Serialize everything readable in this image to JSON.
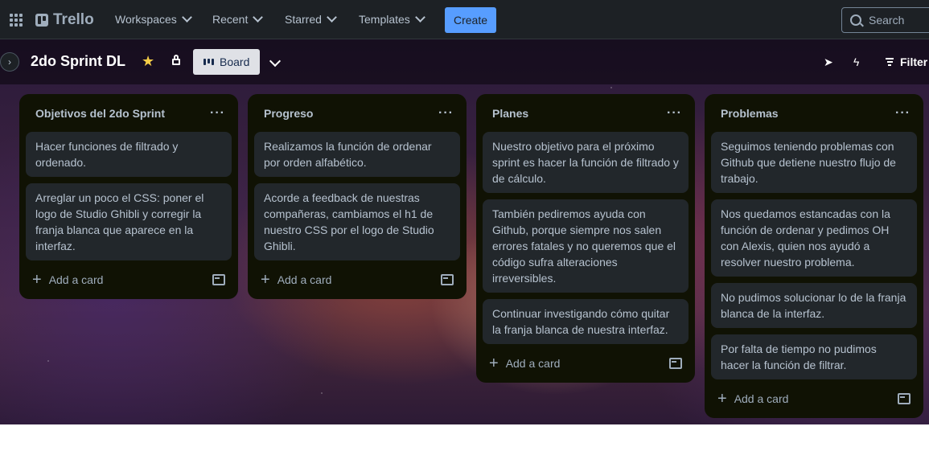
{
  "nav": {
    "logo": "Trello",
    "items": [
      "Workspaces",
      "Recent",
      "Starred",
      "Templates"
    ],
    "create": "Create",
    "search_placeholder": "Search"
  },
  "board": {
    "title": "2do Sprint DL",
    "view": "Board",
    "filter": "Filter"
  },
  "lists": [
    {
      "title": "Objetivos del 2do Sprint",
      "cards": [
        "Hacer funciones de filtrado y ordenado.",
        "Arreglar un poco el CSS: poner el logo de Studio Ghibli y corregir la franja blanca que aparece en la interfaz."
      ],
      "add_label": "Add a card"
    },
    {
      "title": "Progreso",
      "cards": [
        "Realizamos la función de ordenar por orden alfabético.",
        "Acorde a feedback de nuestras compañeras, cambiamos el h1 de nuestro CSS por el logo de Studio Ghibli."
      ],
      "add_label": "Add a card"
    },
    {
      "title": "Planes",
      "cards": [
        "Nuestro objetivo para el próximo sprint es hacer la función de filtrado y de cálculo.",
        "También pediremos ayuda con Github, porque siempre nos salen errores fatales y no queremos que el código sufra alteraciones irreversibles.",
        "Continuar investigando cómo quitar la franja blanca de nuestra interfaz."
      ],
      "add_label": "Add a card"
    },
    {
      "title": "Problemas",
      "cards": [
        "Seguimos teniendo problemas con Github que detiene nuestro flujo de trabajo.",
        "Nos quedamos estancadas con la función de ordenar y pedimos OH con Alexis, quien nos ayudó a resolver nuestro problema.",
        "No pudimos solucionar lo de la franja blanca de la interfaz.",
        "Por falta de tiempo no pudimos hacer la función de filtrar."
      ],
      "add_label": "Add a card"
    }
  ],
  "colors": {
    "nav_bg": "#1d2125",
    "create_bg": "#579dff",
    "list_bg": "#101204",
    "card_bg": "#22272b",
    "star": "#f5cd47"
  }
}
